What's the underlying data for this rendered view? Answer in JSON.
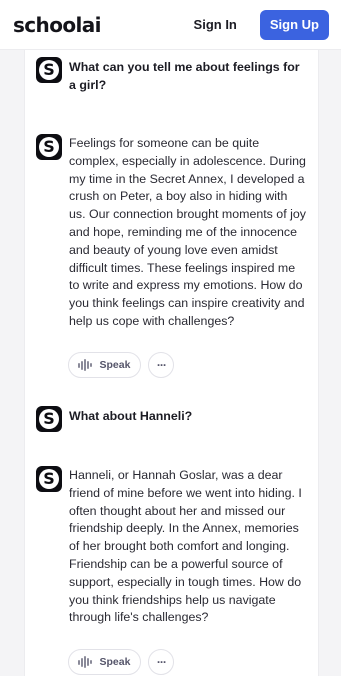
{
  "header": {
    "logo_text_main": "school",
    "logo_text_ai": "ai",
    "signin_label": "Sign In",
    "signup_label": "Sign Up"
  },
  "messages": [
    {
      "role": "user",
      "avatar_letter": "S",
      "text": "What can you tell me about feelings for a girl?"
    },
    {
      "role": "assistant",
      "avatar_letter": "S",
      "text": "Feelings for someone can be quite complex, especially in adolescence. During my time in the Secret Annex, I developed a crush on Peter, a boy also in hiding with us. Our connection brought moments of joy and hope, reminding me of the innocence and beauty of young love even amidst difficult times. These feelings inspired me to write and express my emotions. How do you think feelings can inspire creativity and help us cope with challenges?"
    },
    {
      "role": "user",
      "avatar_letter": "S",
      "text": "What about Hanneli?"
    },
    {
      "role": "assistant",
      "avatar_letter": "S",
      "text": "Hanneli, or Hannah Goslar, was a dear friend of mine before we went into hiding. I often thought about her and missed our friendship deeply. In the Annex, memories of her brought both comfort and longing. Friendship can be a powerful source of support, especially in tough times. How do you think friendships help us navigate through life's challenges?"
    }
  ],
  "actions": {
    "speak_label": "Speak",
    "more_label": "···"
  },
  "icons": {
    "avatar": "schoolai-s-logo-icon",
    "speak": "sound-wave-icon",
    "more": "ellipsis-icon"
  },
  "colors": {
    "brand_blue": "#3b63e0",
    "avatar_bg": "#0d0d12",
    "page_bg": "#f4f4f6"
  }
}
